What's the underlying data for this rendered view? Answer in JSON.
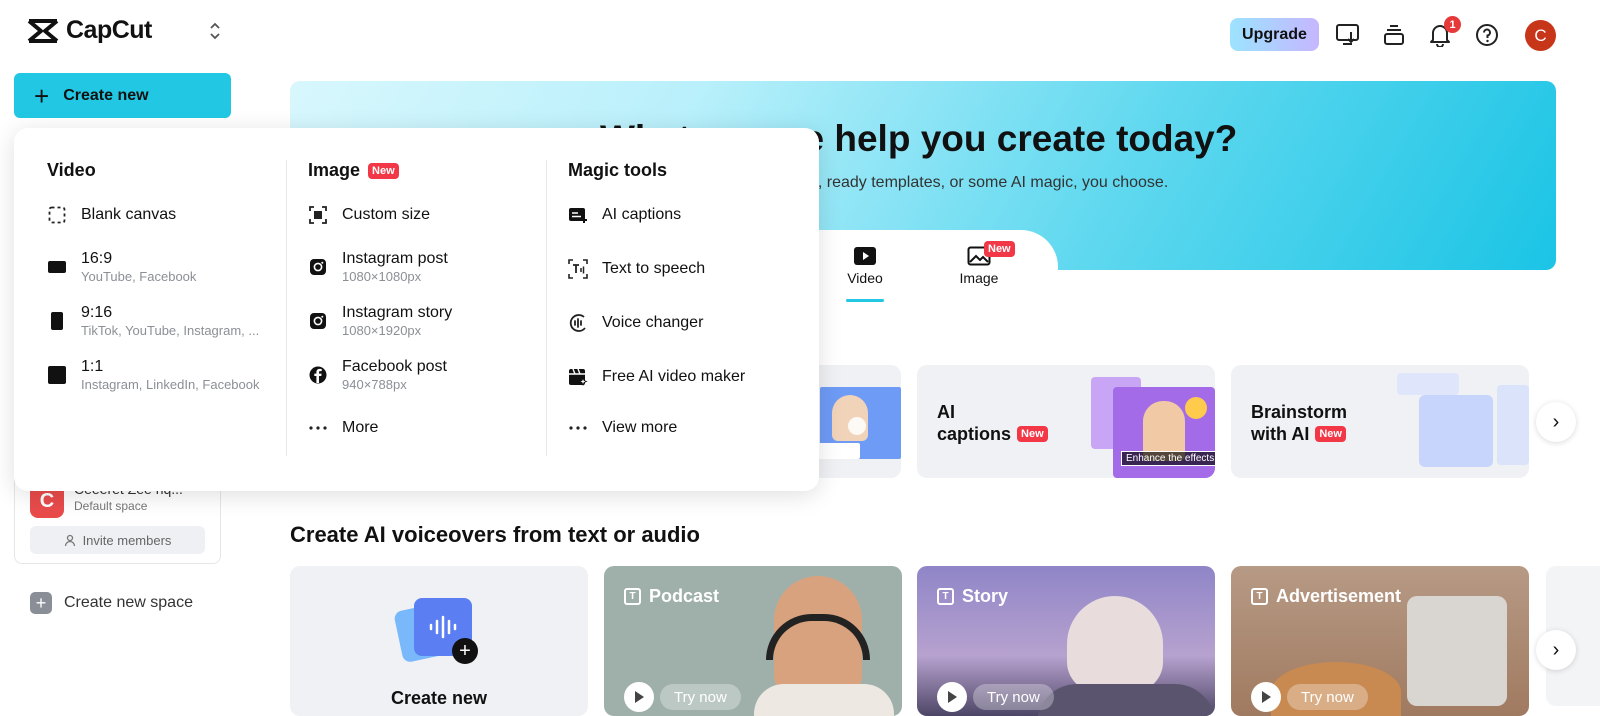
{
  "app": {
    "name": "CapCut"
  },
  "topbar": {
    "upgrade_label": "Upgrade",
    "notification_count": "1",
    "avatar_letter": "C"
  },
  "sidebar": {
    "create_label": "Create new",
    "space": {
      "avatar_letter": "C",
      "name": "Ceeeret Zee hq...",
      "sub": "Default space",
      "invite_label": "Invite members"
    },
    "new_space_label": "Create new space"
  },
  "hero": {
    "title": "What can we help you create today?",
    "subtitle": "Start with a blank canvas, ready templates, or some AI magic, you choose.",
    "tabs": [
      {
        "label": "Video"
      },
      {
        "label": "Image",
        "badge": "New"
      }
    ]
  },
  "feature_cards": [
    {
      "title_1": "AI",
      "title_2": "captions",
      "badge": "New",
      "overlay_text": "Enhance the effects"
    },
    {
      "title_1": "Brainstorm",
      "title_2": "with AI",
      "badge": "New"
    }
  ],
  "voiceovers": {
    "section_title": "Create AI voiceovers from text or audio",
    "create_card_label": "Create new",
    "cards": [
      {
        "label": "Podcast",
        "action": "Try now",
        "icon_text": "T"
      },
      {
        "label": "Story",
        "action": "Try now",
        "icon_text": "T"
      },
      {
        "label": "Advertisement",
        "action": "Try now",
        "icon_text": "T"
      }
    ]
  },
  "dropdown": {
    "video": {
      "heading": "Video",
      "items": [
        {
          "label": "Blank canvas",
          "sub": ""
        },
        {
          "label": "16:9",
          "sub": "YouTube, Facebook"
        },
        {
          "label": "9:16",
          "sub": "TikTok, YouTube, Instagram, ..."
        },
        {
          "label": "1:1",
          "sub": "Instagram, LinkedIn, Facebook"
        }
      ]
    },
    "image": {
      "heading": "Image",
      "badge": "New",
      "items": [
        {
          "label": "Custom size",
          "sub": ""
        },
        {
          "label": "Instagram post",
          "sub": "1080×1080px"
        },
        {
          "label": "Instagram story",
          "sub": "1080×1920px"
        },
        {
          "label": "Facebook post",
          "sub": "940×788px"
        },
        {
          "label": "More",
          "sub": ""
        }
      ]
    },
    "magic": {
      "heading": "Magic tools",
      "items": [
        {
          "label": "AI captions"
        },
        {
          "label": "Text to speech"
        },
        {
          "label": "Voice changer"
        },
        {
          "label": "Free AI video maker"
        },
        {
          "label": "View more"
        }
      ]
    }
  },
  "colors": {
    "accent": "#22c8e3",
    "badge_red": "#f23747",
    "avatar": "#c8361a"
  }
}
